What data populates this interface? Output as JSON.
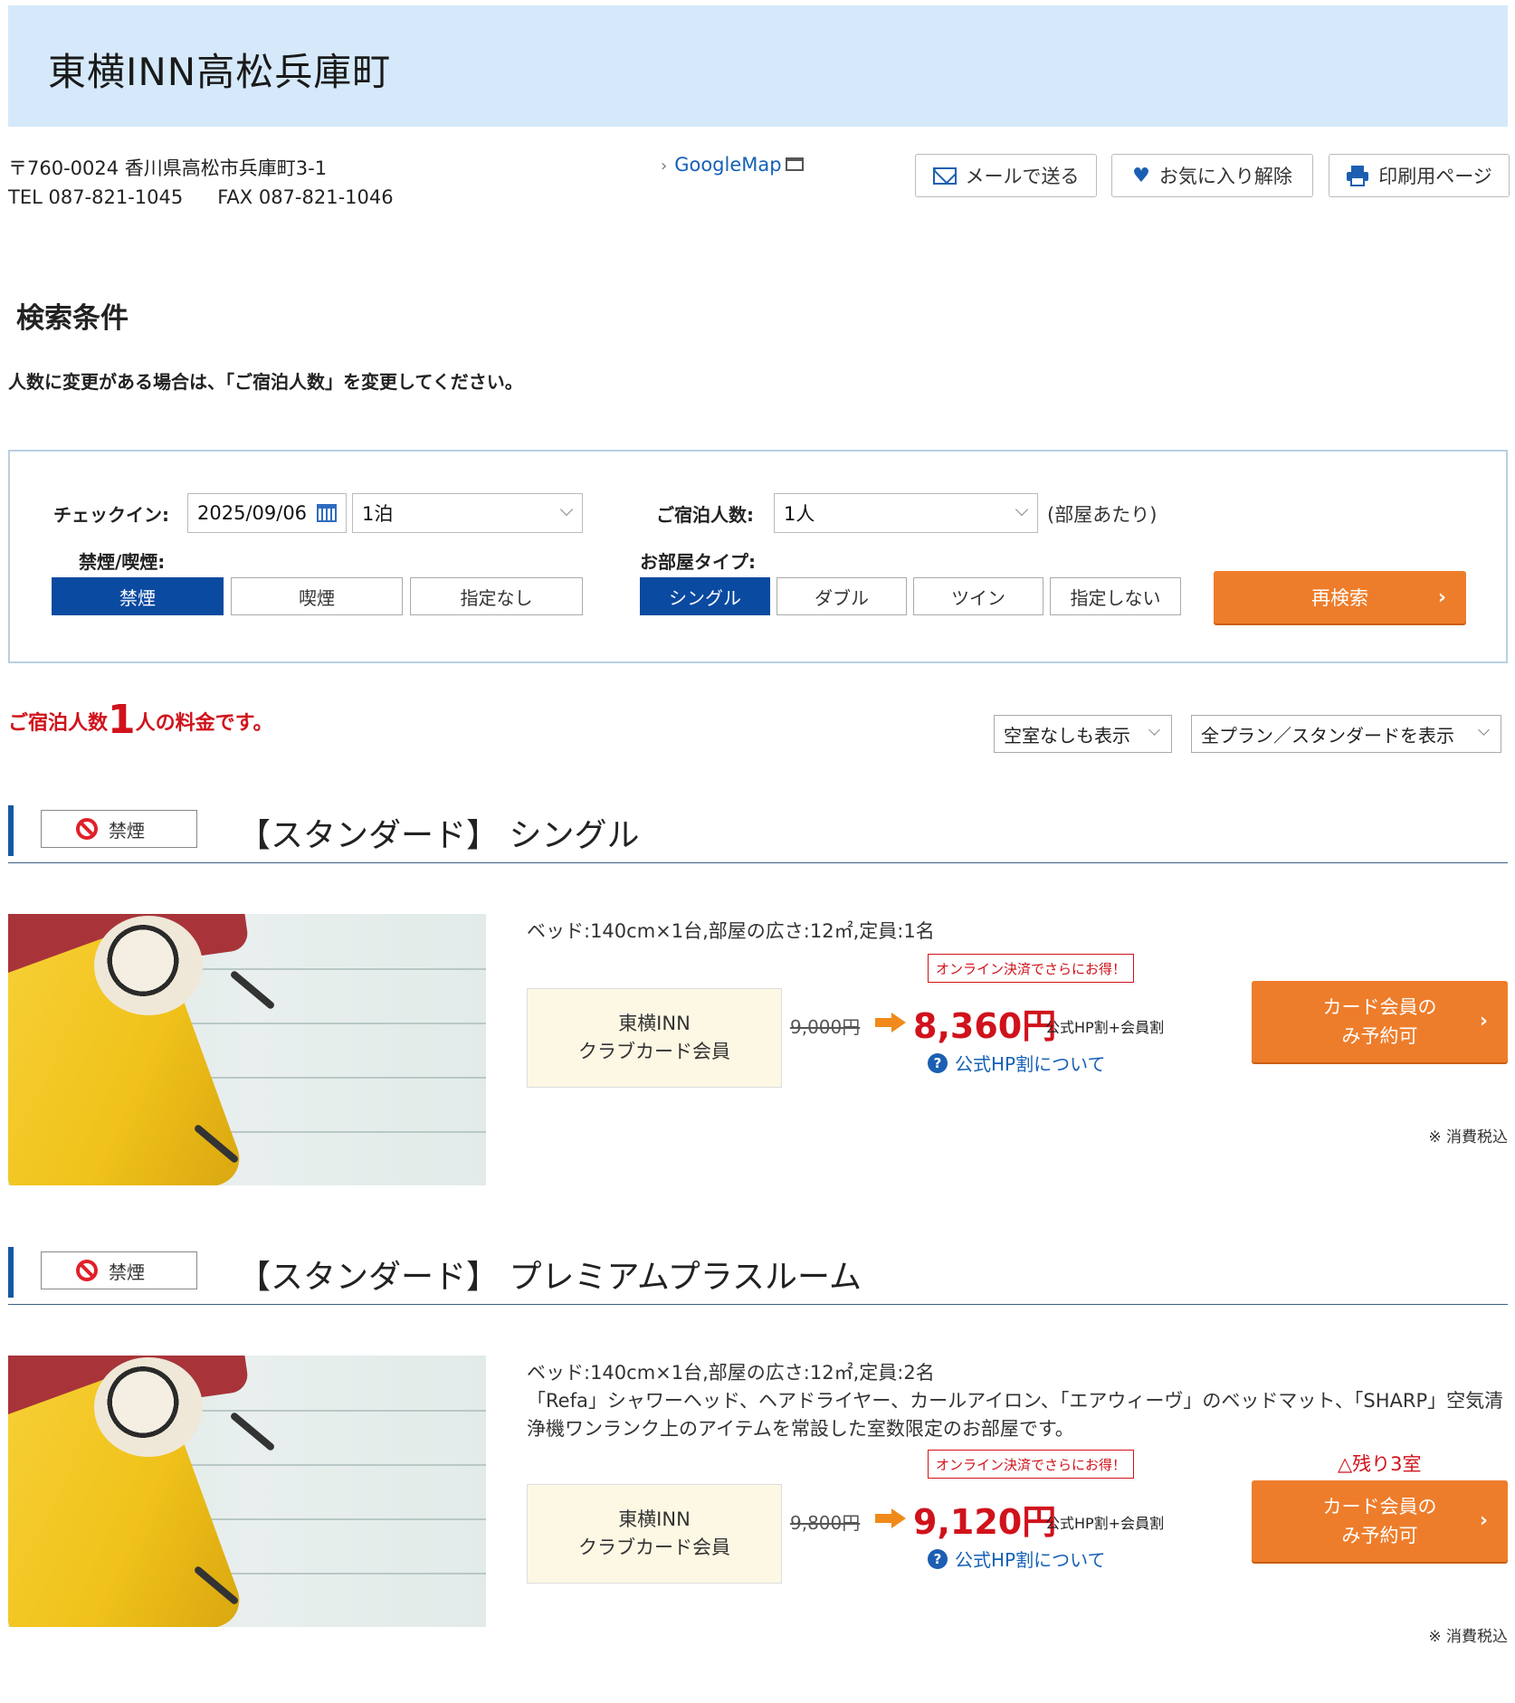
{
  "hotel": {
    "name": "東横INN高松兵庫町",
    "postal_address": "〒760-0024 香川県高松市兵庫町3-1",
    "tel": "TEL 087-821-1045",
    "fax": "FAX 087-821-1046",
    "map_link": "GoogleMap"
  },
  "header_buttons": {
    "mail": "メールで送る",
    "favorite": "お気に入り解除",
    "print": "印刷用ページ"
  },
  "search": {
    "title": "検索条件",
    "notice": "人数に変更がある場合は、「ご宿泊人数」を変更してください。",
    "checkin_label": "チェックイン:",
    "checkin_date": "2025/09/06",
    "nights": "1泊",
    "guests_label": "ご宿泊人数:",
    "guests": "1人",
    "guests_suffix": "(部屋あたり)",
    "smoking_label": "禁煙/喫煙:",
    "smoking_options": [
      "禁煙",
      "喫煙",
      "指定なし"
    ],
    "smoking_selected": "禁煙",
    "room_type_label": "お部屋タイプ:",
    "room_type_options": [
      "シングル",
      "ダブル",
      "ツイン",
      "指定しない"
    ],
    "room_type_selected": "シングル",
    "research_button": "再検索"
  },
  "results": {
    "note_prefix": "ご宿泊人数",
    "note_count": "1",
    "note_suffix": "人の料金です。",
    "filter_vacancy": "空室なしも表示",
    "filter_plan": "全プラン／スタンダードを表示"
  },
  "rooms": [
    {
      "badge": "禁煙",
      "name": "【スタンダード】 シングル",
      "specs": "ベッド:140cm×1台,部屋の広さ:12㎡,定員:1名",
      "description": "",
      "online_tag": "オンライン決済でさらにお得！",
      "member_line1": "東横INN",
      "member_line2": "クラブカード会員",
      "old_price": "9,000円",
      "new_price": "8,360円",
      "discount": "公式HP割+会員割",
      "hp_link": "公式HP割について",
      "remaining": "",
      "reserve_line1": "カード会員の",
      "reserve_line2": "み予約可",
      "tax": "※ 消費税込"
    },
    {
      "badge": "禁煙",
      "name": "【スタンダード】 プレミアムプラスルーム",
      "specs": "ベッド:140cm×1台,部屋の広さ:12㎡,定員:2名",
      "description": "「Refa」シャワーヘッド、ヘアドライヤー、カールアイロン、「エアウィーヴ」のベッドマット、「SHARP」空気清浄機ワンランク上のアイテムを常設した室数限定のお部屋です。",
      "online_tag": "オンライン決済でさらにお得！",
      "member_line1": "東横INN",
      "member_line2": "クラブカード会員",
      "old_price": "9,800円",
      "new_price": "9,120円",
      "discount": "公式HP割+会員割",
      "hp_link": "公式HP割について",
      "remaining": "△残り3室",
      "reserve_line1": "カード会員の",
      "reserve_line2": "み予約可",
      "tax": "※ 消費税込"
    }
  ],
  "icons": {
    "mail": "mail-icon",
    "heart": "heart-icon",
    "print": "printer-icon",
    "calendar": "calendar-icon",
    "no_smoking": "no-smoking-icon",
    "question": "question-icon",
    "external_window": "external-window-icon"
  },
  "colors": {
    "header_bg": "#d5e9fb",
    "selected_blue": "#0a4aa0",
    "accent_orange": "#ee7d2b",
    "price_red": "#d0121b",
    "link_blue": "#1561b5"
  }
}
